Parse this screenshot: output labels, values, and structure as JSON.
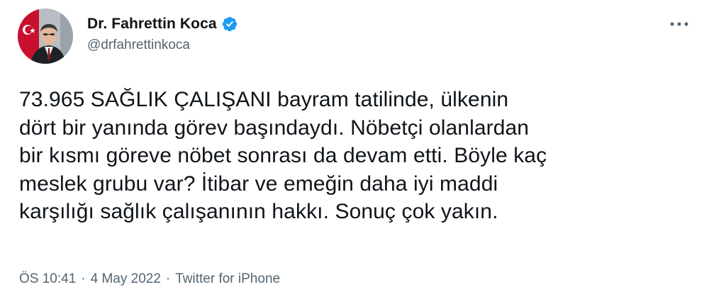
{
  "tweet": {
    "author": {
      "display_name": "Dr. Fahrettin Koca",
      "handle": "@drfahrettinkoca",
      "verified": true,
      "verified_color": "#1d9bf0"
    },
    "text": "73.965 SAĞLIK ÇALIŞANI bayram tatilinde, ülkenin\ndört bir yanında görev başındaydı. Nöbetçi olanlardan\nbir kısmı göreve nöbet sonrası da devam etti. Böyle kaç\nmeslek grubu var? İtibar ve emeğin daha iyi maddi\nkarşılığı sağlık çalışanının hakkı. Sonuç çok yakın.",
    "meta": {
      "time": "ÖS 10:41",
      "separator": "·",
      "date": "4 May 2022",
      "source": "Twitter for iPhone"
    },
    "icons": {
      "more": "more-horizontal-icon",
      "verified": "verified-badge-icon"
    }
  }
}
